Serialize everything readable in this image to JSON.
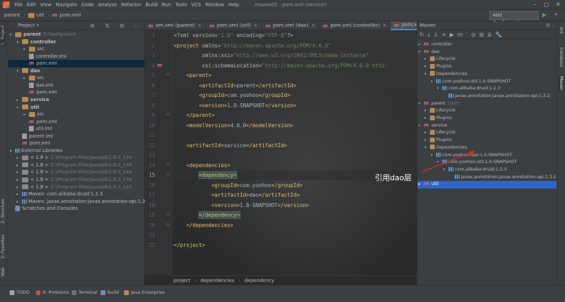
{
  "menubar": {
    "items": [
      "File",
      "Edit",
      "View",
      "Navigate",
      "Code",
      "Analyze",
      "Refactor",
      "Build",
      "Run",
      "Tools",
      "VCS",
      "Window",
      "Help"
    ],
    "title": "maven02 - pom.xml (service)"
  },
  "navbar": {
    "crumbs": [
      "parent",
      "util",
      "pom.xml"
    ],
    "add_config": "Add Configuration..."
  },
  "left_strip": {
    "tabs": [
      "1: Project",
      "Z: Structure",
      "2: Favorites",
      "Web"
    ]
  },
  "project": {
    "title": "Project",
    "rows": [
      {
        "depth": 0,
        "arrow": "▾",
        "icon": "folder",
        "label": "parent",
        "extra": "D:\\test\\parent",
        "bold": true
      },
      {
        "depth": 1,
        "arrow": "▾",
        "icon": "folder",
        "label": "controller",
        "bold": true
      },
      {
        "depth": 2,
        "arrow": "▸",
        "icon": "folder",
        "label": "src"
      },
      {
        "depth": 2,
        "arrow": "",
        "icon": "file",
        "label": "controller.iml"
      },
      {
        "depth": 2,
        "arrow": "",
        "icon": "m",
        "label": "pom.xml",
        "selected": true
      },
      {
        "depth": 1,
        "arrow": "▾",
        "icon": "folder",
        "label": "dao",
        "bold": true
      },
      {
        "depth": 2,
        "arrow": "▸",
        "icon": "folder",
        "label": "src"
      },
      {
        "depth": 2,
        "arrow": "",
        "icon": "file",
        "label": "dao.iml"
      },
      {
        "depth": 2,
        "arrow": "",
        "icon": "m",
        "label": "pom.xml"
      },
      {
        "depth": 1,
        "arrow": "▸",
        "icon": "folder",
        "label": "service",
        "bold": true
      },
      {
        "depth": 1,
        "arrow": "▾",
        "icon": "folder",
        "label": "util",
        "bold": true
      },
      {
        "depth": 2,
        "arrow": "▸",
        "icon": "folder",
        "label": "src"
      },
      {
        "depth": 2,
        "arrow": "",
        "icon": "m",
        "label": "pom.xml"
      },
      {
        "depth": 2,
        "arrow": "",
        "icon": "file",
        "label": "util.iml"
      },
      {
        "depth": 1,
        "arrow": "",
        "icon": "file",
        "label": "parent.iml"
      },
      {
        "depth": 1,
        "arrow": "",
        "icon": "m",
        "label": "pom.xml"
      },
      {
        "depth": 0,
        "arrow": "▾",
        "icon": "lib",
        "label": "External Libraries"
      },
      {
        "depth": 1,
        "arrow": "▸",
        "icon": "jdk",
        "label": "< 1.8 >",
        "extra": "C:\\Program Files\\Java\\jdk1.8.0_144"
      },
      {
        "depth": 1,
        "arrow": "▸",
        "icon": "jdk",
        "label": "< 1.8 >",
        "extra": "C:\\Program Files\\Java\\jdk1.8.0_144"
      },
      {
        "depth": 1,
        "arrow": "▸",
        "icon": "jdk",
        "label": "< 1.8 >",
        "extra": "C:\\Program Files\\Java\\jdk1.8.0_144"
      },
      {
        "depth": 1,
        "arrow": "▸",
        "icon": "jdk",
        "label": "< 1.8 >",
        "extra": "C:\\Program Files\\Java\\jdk1.8.0_144"
      },
      {
        "depth": 1,
        "arrow": "▸",
        "icon": "jdk",
        "label": "< 1.8 >",
        "extra": "C:\\Program Files\\Java\\jdk1.8.0_144"
      },
      {
        "depth": 1,
        "arrow": "▸",
        "icon": "lib",
        "label": "Maven: com.alibaba:druid:1.2.3"
      },
      {
        "depth": 1,
        "arrow": "▸",
        "icon": "lib",
        "label": "Maven: javax.annotation:javax.annotation-api:1.3.2"
      },
      {
        "depth": 0,
        "arrow": "",
        "icon": "scratch",
        "label": "Scratches and Consoles"
      }
    ]
  },
  "editor": {
    "tabs": [
      {
        "label": "om.xml (parent)",
        "active": false
      },
      {
        "label": "pom.xml (util)",
        "active": false
      },
      {
        "label": "pom.xml (dao)",
        "active": false
      },
      {
        "label": "pom.xml (controller)",
        "active": false
      },
      {
        "label": "pom.xml (service)",
        "active": true
      }
    ],
    "current_line": 15,
    "lines": [
      {
        "n": "1",
        "segs": [
          [
            "a",
            "<?xml version="
          ],
          [
            "v",
            "\"1.0\""
          ],
          [
            "a",
            " encoding="
          ],
          [
            "v",
            "\"UTF-8\""
          ],
          [
            "a",
            "?>"
          ]
        ]
      },
      {
        "n": "2",
        "segs": [
          [
            "t",
            "<project"
          ],
          [
            "a",
            " xmlns="
          ],
          [
            "v",
            "\"http://maven.apache.org/POM/4.0.0\""
          ]
        ]
      },
      {
        "n": "3",
        "segs": [
          [
            "a",
            "         xmlns:xsi="
          ],
          [
            "v",
            "\"http://www.w3.org/2001/XMLSchema-instance\""
          ]
        ]
      },
      {
        "n": "4",
        "segs": [
          [
            "a",
            "         xsi:schemaLocation="
          ],
          [
            "v",
            "\"http://maven.apache.org/POM/4.0.0 http:"
          ]
        ]
      },
      {
        "n": "5",
        "segs": [
          [
            "t",
            "    <parent>"
          ]
        ]
      },
      {
        "n": "6",
        "segs": [
          [
            "t",
            "        <artifactId>"
          ],
          [
            "p",
            "parent"
          ],
          [
            "t",
            "</artifactId>"
          ]
        ]
      },
      {
        "n": "7",
        "segs": [
          [
            "t",
            "        <groupId>"
          ],
          [
            "p",
            "com.yoohoo"
          ],
          [
            "t",
            "</groupId>"
          ]
        ]
      },
      {
        "n": "8",
        "segs": [
          [
            "t",
            "        <version>"
          ],
          [
            "p",
            "1.0-SNAPSHOT"
          ],
          [
            "t",
            "</version>"
          ]
        ]
      },
      {
        "n": "9",
        "segs": [
          [
            "t",
            "    </parent>"
          ]
        ]
      },
      {
        "n": "10",
        "segs": [
          [
            "t",
            "    <modelVersion>"
          ],
          [
            "p",
            "4.0.0"
          ],
          [
            "t",
            "</modelVersion>"
          ]
        ]
      },
      {
        "n": "11",
        "segs": []
      },
      {
        "n": "12",
        "segs": [
          [
            "t",
            "    <artifactId>"
          ],
          [
            "p",
            "service"
          ],
          [
            "t",
            "</artifactId>"
          ]
        ]
      },
      {
        "n": "13",
        "segs": []
      },
      {
        "n": "14",
        "segs": [
          [
            "t",
            "    <dependencies>"
          ]
        ]
      },
      {
        "n": "15",
        "segs": [
          [
            "p",
            "        "
          ],
          [
            "th",
            "<dependency>"
          ]
        ]
      },
      {
        "n": "16",
        "segs": [
          [
            "t",
            "            <groupId>"
          ],
          [
            "p",
            "com.yoohoo"
          ],
          [
            "t",
            "</groupId>"
          ]
        ]
      },
      {
        "n": "17",
        "segs": [
          [
            "t",
            "            <artifactId>"
          ],
          [
            "p",
            "dao"
          ],
          [
            "t",
            "</artifactId>"
          ]
        ]
      },
      {
        "n": "18",
        "segs": [
          [
            "t",
            "            <version>"
          ],
          [
            "p",
            "1.0-SNAPSHOT"
          ],
          [
            "t",
            "</version>"
          ]
        ]
      },
      {
        "n": "19",
        "segs": [
          [
            "p",
            "        "
          ],
          [
            "th",
            "</dependency>"
          ]
        ]
      },
      {
        "n": "20",
        "segs": [
          [
            "t",
            "    </dependencies>"
          ]
        ]
      },
      {
        "n": "21",
        "segs": []
      },
      {
        "n": "22",
        "segs": [
          [
            "t",
            "</project>"
          ]
        ]
      }
    ],
    "breadcrumbs": [
      "project",
      "dependencies",
      "dependency"
    ]
  },
  "maven": {
    "title": "Maven",
    "rows": [
      {
        "depth": 0,
        "arrow": "▸",
        "icon": "m",
        "label": "controller"
      },
      {
        "depth": 0,
        "arrow": "▾",
        "icon": "m",
        "label": "dao"
      },
      {
        "depth": 1,
        "arrow": "▸",
        "icon": "lc",
        "label": "Lifecycle"
      },
      {
        "depth": 1,
        "arrow": "▸",
        "icon": "lc",
        "label": "Plugins"
      },
      {
        "depth": 1,
        "arrow": "▾",
        "icon": "lc",
        "label": "Dependencies"
      },
      {
        "depth": 2,
        "arrow": "▾",
        "icon": "dep",
        "label": "com.yoohoo:util:1.0-SNAPSHOT"
      },
      {
        "depth": 3,
        "arrow": "▾",
        "icon": "dep",
        "label": "com.alibaba:druid:1.2.3"
      },
      {
        "depth": 4,
        "arrow": "",
        "icon": "dep",
        "label": "javax.annotation:javax.annotation-api:1.3.2"
      },
      {
        "depth": 0,
        "arrow": "▾",
        "icon": "m",
        "label": "parent",
        "extra": "(root)"
      },
      {
        "depth": 1,
        "arrow": "▸",
        "icon": "lc",
        "label": "Lifecycle"
      },
      {
        "depth": 1,
        "arrow": "▸",
        "icon": "lc",
        "label": "Plugins"
      },
      {
        "depth": 0,
        "arrow": "▾",
        "icon": "m",
        "label": "service"
      },
      {
        "depth": 1,
        "arrow": "▸",
        "icon": "lc",
        "label": "Lifecycle"
      },
      {
        "depth": 1,
        "arrow": "▸",
        "icon": "lc",
        "label": "Plugins"
      },
      {
        "depth": 1,
        "arrow": "▾",
        "icon": "lc",
        "label": "Dependencies"
      },
      {
        "depth": 2,
        "arrow": "▾",
        "icon": "dep",
        "label": "com.yoohoo:dao:1.0-SNAPSHOT"
      },
      {
        "depth": 3,
        "arrow": "▾",
        "icon": "dep",
        "label": "com.yoohoo:util:1.0-SNAPSHOT"
      },
      {
        "depth": 4,
        "arrow": "▾",
        "icon": "dep",
        "label": "com.alibaba:druid:1.2.3"
      },
      {
        "depth": 5,
        "arrow": "",
        "icon": "dep",
        "label": "javax.annotation:javax.annotation-api:1.3.2"
      },
      {
        "depth": 0,
        "arrow": "▸",
        "icon": "m",
        "label": "util",
        "selected": true
      }
    ]
  },
  "right_strip": {
    "tabs": [
      "Ant",
      "Database",
      "Maven"
    ]
  },
  "statusbar": {
    "items": [
      "TODO",
      "6: Problems",
      "Terminal",
      "Build",
      "Java Enterprise"
    ]
  },
  "annotation": {
    "text": "引用dao层"
  },
  "colors": {
    "accent": "#4a88c7",
    "selection": "#2f65ca",
    "tag": "#e8bf6a",
    "string": "#6a8759",
    "arrow": "#e0282e"
  }
}
